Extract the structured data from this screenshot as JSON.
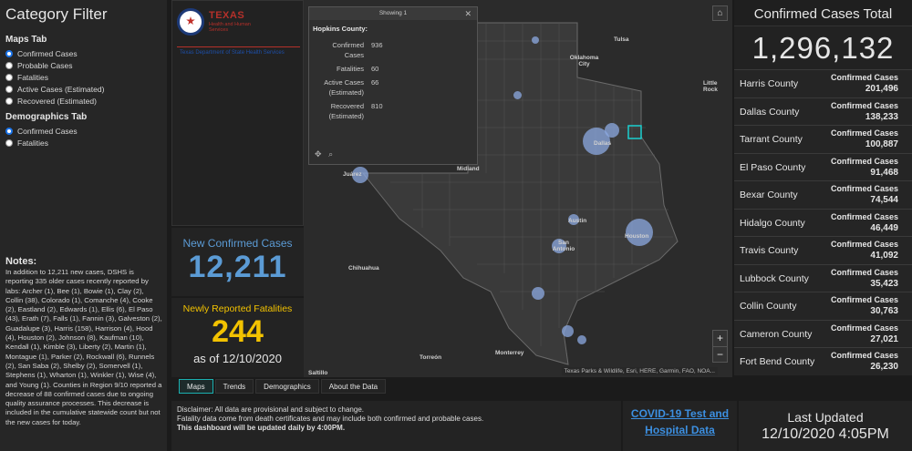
{
  "sidebar": {
    "title": "Category Filter",
    "maps_tab_label": "Maps Tab",
    "maps_options": [
      "Confirmed Cases",
      "Probable Cases",
      "Fatalities",
      "Active Cases (Estimated)",
      "Recovered (Estimated)"
    ],
    "maps_selected": 0,
    "demographics_tab_label": "Demographics Tab",
    "demo_options": [
      "Confirmed Cases",
      "Fatalities"
    ],
    "demo_selected": 0,
    "notes_title": "Notes:",
    "notes_text": "In addition to 12,211 new cases, DSHS is reporting 335 older cases recently reported by labs: Archer (1), Bee (1), Bowie (1), Clay (2), Collin (38), Colorado (1), Comanche (4), Cooke (2), Eastland (2), Edwards (1), Ellis (6), El Paso (43), Erath (7), Falls (1), Fannin (3), Galveston (2), Guadalupe (3), Harris (158), Harrison (4), Hood (4), Houston (2), Johnson (8), Kaufman (10), Kendall (1), Kimble (3), Liberty (2), Martin (1), Montague (1), Parker (2), Rockwall (6), Runnels (2), San Saba (2), Shelby (2), Somervell (1), Stephens (1), Wharton (1), Winkler (1), Wise (4), and Young (1). Counties in Region 9/10 reported a decrease of 88 confirmed cases due to ongoing quality assurance processes. This decrease is included in the cumulative statewide count but not the new cases for today."
  },
  "logo": {
    "line1": "TEXAS",
    "line2": "Health and Human Services",
    "line3": "Texas Department of State Health Services"
  },
  "stats": {
    "new_cases_label": "New Confirmed Cases",
    "new_cases_value": "12,211",
    "new_fatalities_label": "Newly Reported Fatalities",
    "new_fatalities_value": "244",
    "as_of": "as of 12/10/2020"
  },
  "map": {
    "places": [
      "Tulsa",
      "Oklahoma City",
      "Little Rock",
      "Dallas",
      "Midland",
      "Juárez",
      "Austin",
      "San Antonio",
      "Houston",
      "Chihuahua",
      "Torreón",
      "Monterrey",
      "Saltillo"
    ],
    "attribution": "Texas Parks & Wildlife, Esri, HERE, Garmin, FAO, NOA...",
    "popup": {
      "header": "Showing 1",
      "county": "Hopkins County:",
      "rows": [
        {
          "k": "Confirmed Cases",
          "v": "936"
        },
        {
          "k": "Fatalities",
          "v": "60"
        },
        {
          "k": "Active Cases (Estimated)",
          "v": "66"
        },
        {
          "k": "Recovered (Estimated)",
          "v": "810"
        }
      ]
    },
    "zoom_in": "+",
    "zoom_out": "−",
    "home_icon": "⌂"
  },
  "right_panel": {
    "title": "Confirmed Cases Total",
    "total": "1,296,132",
    "row_label": "Confirmed Cases",
    "counties": [
      {
        "name": "Harris County",
        "value": "201,496"
      },
      {
        "name": "Dallas County",
        "value": "138,233"
      },
      {
        "name": "Tarrant County",
        "value": "100,887"
      },
      {
        "name": "El Paso County",
        "value": "91,468"
      },
      {
        "name": "Bexar County",
        "value": "74,544"
      },
      {
        "name": "Hidalgo County",
        "value": "46,449"
      },
      {
        "name": "Travis County",
        "value": "41,092"
      },
      {
        "name": "Lubbock County",
        "value": "35,423"
      },
      {
        "name": "Collin County",
        "value": "30,763"
      },
      {
        "name": "Cameron County",
        "value": "27,021"
      },
      {
        "name": "Fort Bend County",
        "value": "26,230"
      }
    ]
  },
  "tabs": [
    "Maps",
    "Trends",
    "Demographics",
    "About the Data"
  ],
  "active_tab": 0,
  "footer": {
    "disclaimer1": "Disclaimer: All data are provisional and subject to change.",
    "disclaimer2": "Fatality data come from death certificates and may include both confirmed and probable cases.",
    "disclaimer3": "This dashboard will be updated daily by 4:00PM.",
    "link": "COVID-19 Test and Hospital Data",
    "last_updated_label": "Last Updated",
    "last_updated_value": "12/10/2020 4:05PM"
  },
  "colors": {
    "accent_blue": "#5b9bd5",
    "accent_yellow": "#f2c200",
    "highlight_cyan": "#1bb0b0",
    "link": "#3c8fe0"
  }
}
